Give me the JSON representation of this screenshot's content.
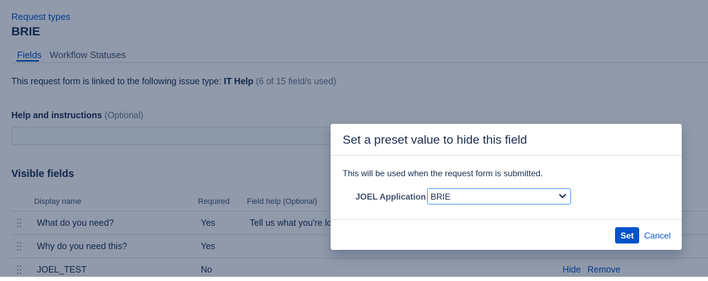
{
  "header": {
    "breadcrumb": "Request types",
    "title": "BRIE"
  },
  "tabs": [
    {
      "label": "Fields",
      "active": true
    },
    {
      "label": "Workflow Statuses",
      "active": false
    }
  ],
  "form_link": {
    "prefix": "This request form is linked to the following issue type:",
    "issue_type": "IT Help",
    "usage": "(6 of 15 field/s used)"
  },
  "help_section": {
    "label": "Help and instructions",
    "optional": "(Optional)"
  },
  "visible_fields": {
    "title": "Visible fields",
    "columns": {
      "display_name": "Display name",
      "required": "Required",
      "field_help": "Field help (Optional)"
    },
    "rows": [
      {
        "display_name": "What do you need?",
        "required": "Yes",
        "field_help": "Tell us what you're loo"
      },
      {
        "display_name": "Why do you need this?",
        "required": "Yes",
        "field_help": ""
      },
      {
        "display_name": "JOEL_TEST",
        "required": "No",
        "field_help": "",
        "actions": [
          "Hide",
          "Remove"
        ]
      }
    ]
  },
  "dialog": {
    "title": "Set a preset value to hide this field",
    "description": "This will be used when the request form is submitted.",
    "field_label": "JOEL Application",
    "selected_value": "BRIE",
    "set_label": "Set",
    "cancel_label": "Cancel"
  },
  "colors": {
    "accent": "#0052cc",
    "text": "#172b4d",
    "muted": "#6b778c",
    "overlay": "rgba(9,30,66,0.45)",
    "focus_border": "#4c9aff"
  },
  "icons": {
    "select_chevron": "chevron-down-icon",
    "drag_handle": "drag-handle-icon"
  }
}
